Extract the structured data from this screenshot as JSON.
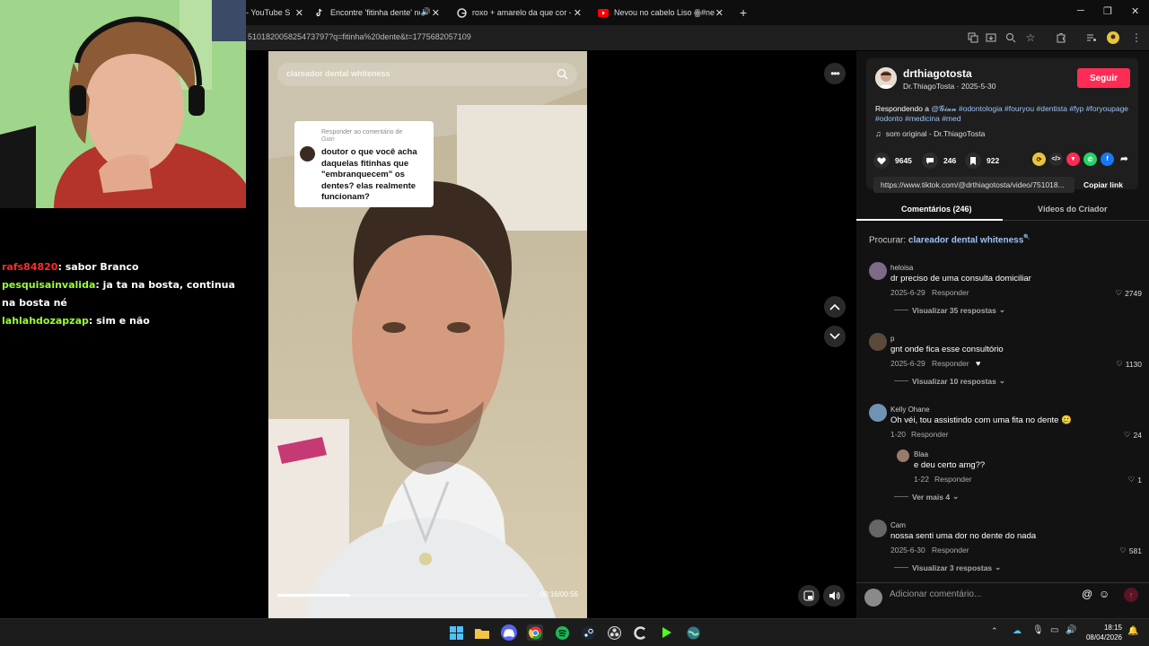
{
  "tabs": [
    {
      "label": "- YouTube S",
      "icon": "youtube-icon"
    },
    {
      "label": "Encontre 'fitinha dente' no",
      "icon": "tiktok-icon",
      "audio": true
    },
    {
      "label": "roxo + amarelo da que cor - Pe",
      "icon": "google-icon"
    },
    {
      "label": "Nevou no cabelo Liso ꙮ#ne",
      "icon": "youtube-icon"
    }
  ],
  "address": {
    "url": "510182005825473797?q=fitinha%20dente&t=1775682057109"
  },
  "chat": [
    {
      "user": "rafs84820",
      "msg": "sabor Branco",
      "color": "#ff2b2b"
    },
    {
      "user": "pesquisainvalida",
      "msg": "ja ta na bosta, continua na bosta né",
      "color": "#9cff3a"
    },
    {
      "user": "lahlahdozapzap",
      "msg": "sim e não",
      "color": "#9cff3a"
    }
  ],
  "video": {
    "search_placeholder": "clareador dental whiteness",
    "reply_label": "Responder ao comentário de",
    "reply_user": "Gian",
    "reply_text": "doutor o que você acha daquelas fitinhas que \"embranquecem\" os dentes? elas realmente funcionam?",
    "time": "00:16/00:56",
    "progress": 0.29
  },
  "creator": {
    "handle": "drthiagotosta",
    "name": "Dr.ThiagoTosta",
    "date": "2025-5-30",
    "follow_label": "Seguir",
    "desc_prefix": "Respondendo a",
    "mention": "@𝓖𝓲𝓪𝓷",
    "tags": "#odontologia #fouryou #dentista #fyp #foryoupage #odonto #medicina #med",
    "sound": "som original - Dr.ThiagoTosta"
  },
  "stats": {
    "likes": "9645",
    "comments": "246",
    "saves": "922"
  },
  "link": {
    "url": "https://www.tiktok.com/@drthiagotosta/video/751018...",
    "copy_label": "Copiar link"
  },
  "panel_tabs": {
    "comments": "Comentários (246)",
    "creator_videos": "Vídeos do Criador"
  },
  "search": {
    "label": "Procurar:",
    "query": "clareador dental whiteness"
  },
  "comments": [
    {
      "name": "heloisa",
      "text": "dr preciso de uma consulta domiciliar",
      "date": "2025-6-29",
      "reply": "Responder",
      "likes": "2749",
      "more": "Visualizar 35 respostas"
    },
    {
      "name": "p",
      "text": "gnt onde fica esse consultório",
      "date": "2025-6-29",
      "reply": "Responder",
      "likes": "1130",
      "more": "Visualizar 10 respostas"
    },
    {
      "name": "Kelly Ohane",
      "text": "Oh véi, tou assistindo com uma fita no dente 🥲",
      "date": "1-20",
      "reply": "Responder",
      "likes": "24",
      "more": ""
    },
    {
      "name": "Blaa",
      "text": "e deu certo amg??",
      "date": "1-22",
      "reply": "Responder",
      "likes": "1",
      "more": "Ver mais 4"
    },
    {
      "name": "Cam",
      "text": "nossa senti uma dor no dente do nada",
      "date": "2025-6-30",
      "reply": "Responder",
      "likes": "581",
      "more": "Visualizar 3 respostas"
    }
  ],
  "comment_input": {
    "placeholder": "Adicionar comentário..."
  },
  "clock": {
    "time": "18:15",
    "date": "08/04/2026"
  },
  "colors": {
    "accent": "#fe2c55",
    "hashtag": "#9cc3f7"
  }
}
